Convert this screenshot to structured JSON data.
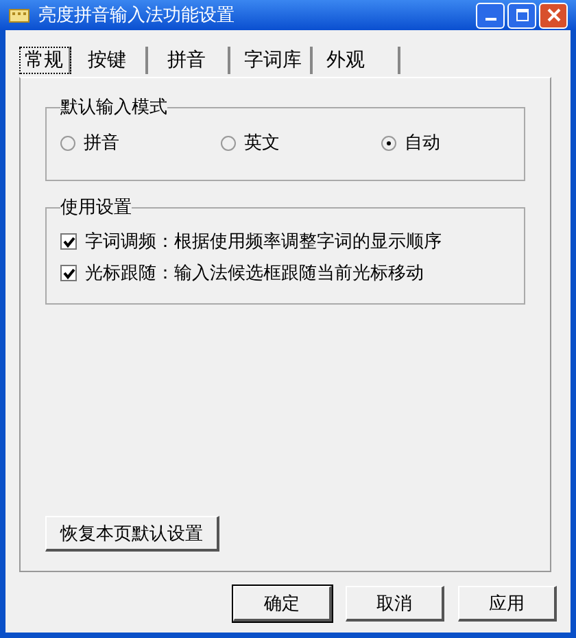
{
  "window": {
    "title": "亮度拼音输入法功能设置"
  },
  "tabs": [
    {
      "label": "常规",
      "selected": true
    },
    {
      "label": "按键",
      "selected": false
    },
    {
      "label": "拼音",
      "selected": false
    },
    {
      "label": "字词库",
      "selected": false
    },
    {
      "label": "外观",
      "selected": false
    }
  ],
  "input_mode": {
    "title": "默认输入模式",
    "options": [
      {
        "label": "拼音",
        "selected": false
      },
      {
        "label": "英文",
        "selected": false
      },
      {
        "label": "自动",
        "selected": true
      }
    ]
  },
  "usage": {
    "title": "使用设置",
    "options": [
      {
        "label": "字词调频：根据使用频率调整字词的显示顺序",
        "checked": true
      },
      {
        "label": "光标跟随：输入法候选框跟随当前光标移动",
        "checked": true
      }
    ]
  },
  "restore_button": "恢复本页默认设置",
  "buttons": [
    "确定",
    "取消",
    "应用"
  ]
}
